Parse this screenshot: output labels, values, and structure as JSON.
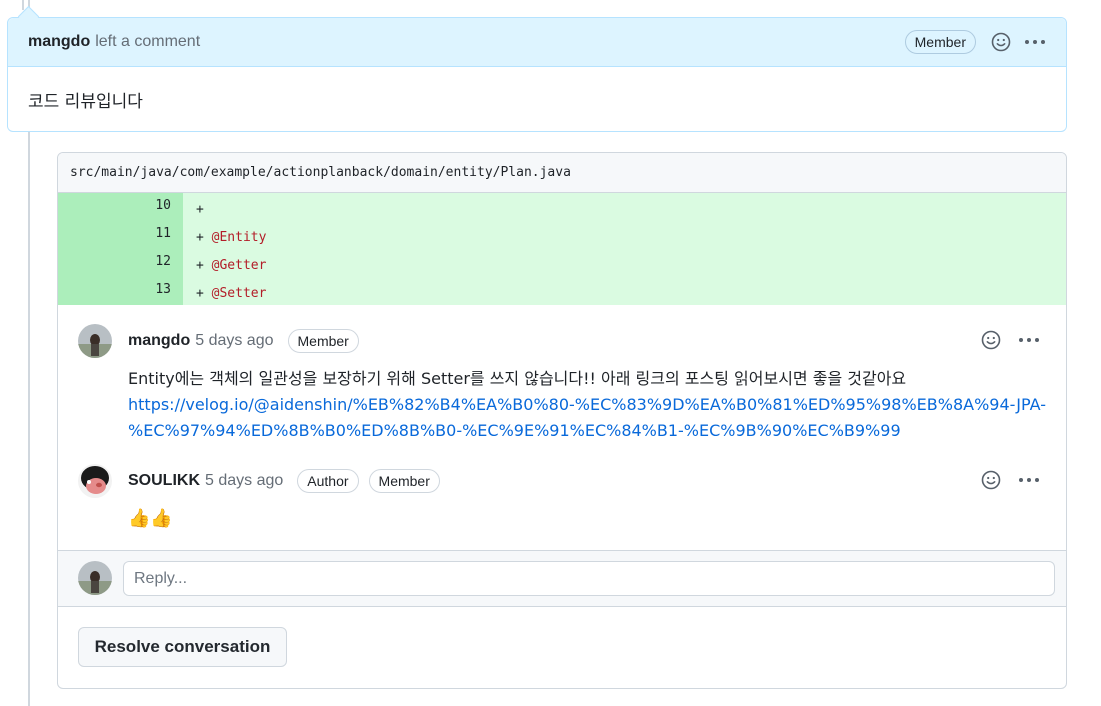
{
  "top_comment": {
    "author": "mangdo",
    "action": "left a comment",
    "badge": "Member",
    "body": "코드 리뷰입니다"
  },
  "thread": {
    "file_path": "src/main/java/com/example/actionplanback/domain/entity/Plan.java",
    "diff_lines": [
      {
        "num": "10",
        "prefix": "+",
        "text": ""
      },
      {
        "num": "11",
        "prefix": "+",
        "text": "@Entity"
      },
      {
        "num": "12",
        "prefix": "+",
        "text": "@Getter"
      },
      {
        "num": "13",
        "prefix": "+",
        "text": "@Setter"
      }
    ],
    "comments": [
      {
        "author": "mangdo",
        "time": "5 days ago",
        "badges": [
          "Member"
        ],
        "text": "Entity에는 객체의 일관성을 보장하기 위해 Setter를 쓰지 않습니다!! 아래 링크의 포스팅 읽어보시면 좋을 것같아요",
        "link_line1": "https://velog.io/@aidenshin/%EB%82%B4%EA%B0%80-%EC%83%9D%EA%B0%81%ED%95%98%EB%8A%94-JPA-",
        "link_line2": "%EC%97%94%ED%8B%B0%ED%8B%B0-%EC%9E%91%EC%84%B1-%EC%9B%90%EC%B9%99"
      },
      {
        "author": "SOULIKK",
        "time": "5 days ago",
        "badges": [
          "Author",
          "Member"
        ],
        "text": "👍👍"
      }
    ],
    "reply_placeholder": "Reply...",
    "resolve_label": "Resolve conversation"
  },
  "colors": {
    "header_bg": "#ddf4ff",
    "diff_add_bg": "#dafbe1",
    "diff_num_bg": "#aceebb",
    "link": "#0969da"
  }
}
